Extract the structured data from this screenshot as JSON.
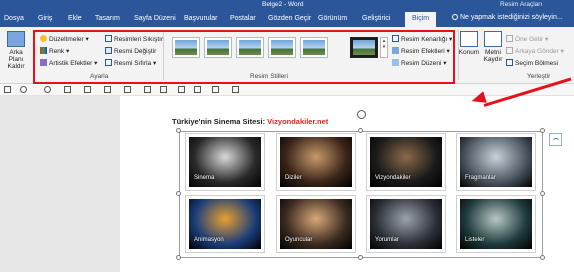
{
  "window": {
    "doc_title": "Belge2 - Word",
    "tools_context": "Resim Araçları"
  },
  "tabs": [
    {
      "label": "Dosya"
    },
    {
      "label": "Giriş"
    },
    {
      "label": "Ekle"
    },
    {
      "label": "Tasarım"
    },
    {
      "label": "Sayfa Düzeni"
    },
    {
      "label": "Başvurular"
    },
    {
      "label": "Postalar"
    },
    {
      "label": "Gözden Geçir"
    },
    {
      "label": "Görünüm"
    },
    {
      "label": "Geliştirici"
    },
    {
      "label": "Biçim",
      "active": true
    }
  ],
  "tell_me": {
    "text": "Ne yapmak istediğinizi söyleyin..."
  },
  "ribbon": {
    "remove_bg": {
      "line1": "Arka Planı",
      "line2": "Kaldır"
    },
    "adjust": {
      "corrections": "Düzeltmeler",
      "color": "Renk",
      "artistic": "Artistik Efektler",
      "compress": "Resimleri Sıkıştır",
      "change": "Resmi Değiştir",
      "reset": "Resmi Sıfırla",
      "group_label": "Ayarla"
    },
    "styles": {
      "group_label": "Resim Stilleri",
      "thumb_count": 6
    },
    "picture_opts": {
      "border": "Resim Kenarlığı",
      "effects": "Resim Efektleri",
      "layout": "Resim Düzeni"
    },
    "arrange": {
      "position": "Konum",
      "wrap_line1": "Metni",
      "wrap_line2": "Kaydır",
      "bring_forward": "Öne Getir",
      "send_backward": "Arkaya Gönder",
      "selection_pane": "Seçim Bölmesi",
      "group_label": "Yerleştir"
    }
  },
  "document": {
    "heading_prefix": "Türkiye'nin Sinema Sitesi: ",
    "heading_site": "Vizyondakiler.net"
  },
  "cards": [
    {
      "caption": "Sinema",
      "bg": "#2a2a2a",
      "accent": "#d9d9d9"
    },
    {
      "caption": "Diziler",
      "bg": "#3a2418",
      "accent": "#c79a6b"
    },
    {
      "caption": "Vizyondakiler",
      "bg": "#1a1a1a",
      "accent": "#8a6a4a"
    },
    {
      "caption": "Fragmanlar",
      "bg": "#4a5560",
      "accent": "#c9d2d8"
    },
    {
      "caption": "Animasyon",
      "bg": "#1b3d7a",
      "accent": "#e8a030"
    },
    {
      "caption": "Oyuncular",
      "bg": "#3a2a20",
      "accent": "#d8a878"
    },
    {
      "caption": "Yorumlar",
      "bg": "#2b2f36",
      "accent": "#9aa3ad"
    },
    {
      "caption": "Listeler",
      "bg": "#1e3a3a",
      "accent": "#b8c7c7"
    }
  ],
  "colors": {
    "brand": "#2b579a",
    "highlight": "#e8101a"
  }
}
